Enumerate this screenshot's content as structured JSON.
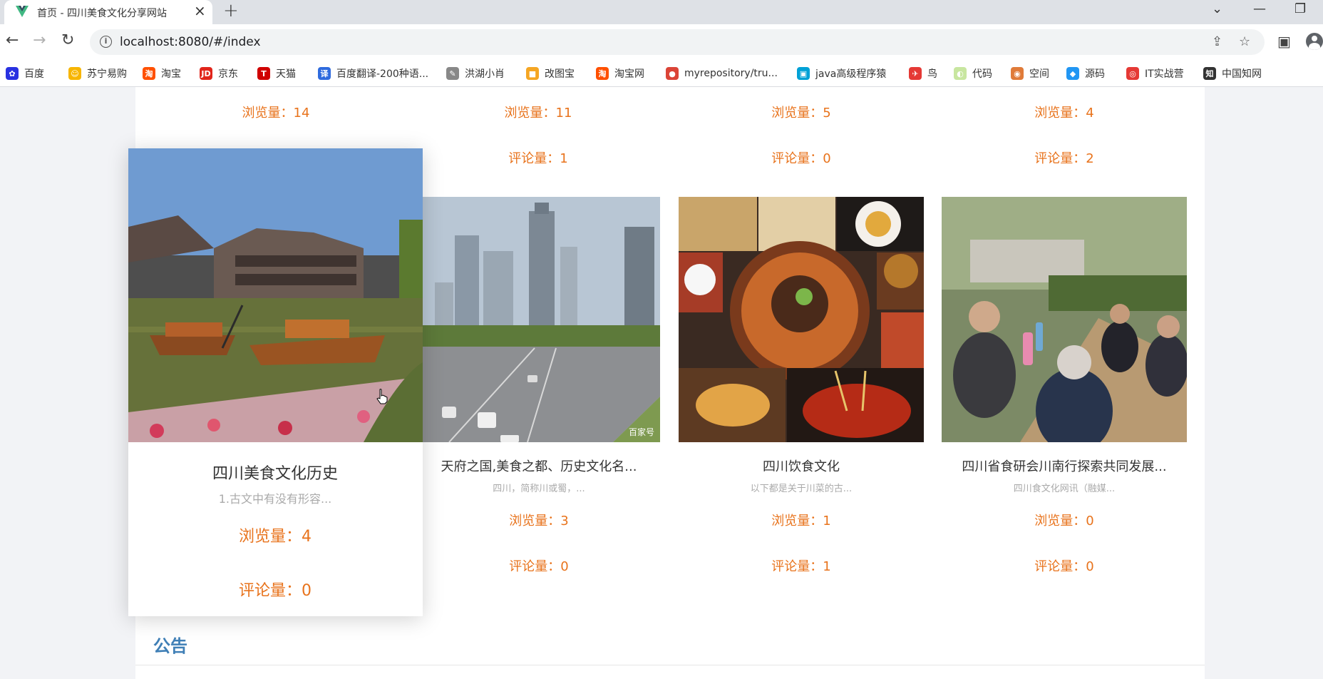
{
  "browser": {
    "tab_title": "首页 - 四川美食文化分享网站",
    "url": "localhost:8080/#/index",
    "bookmarks": [
      {
        "label": "百度",
        "icon": "baidu-icon",
        "color": "#2932e1",
        "glyph": "✿"
      },
      {
        "label": "苏宁易购",
        "icon": "suning-icon",
        "color": "#f7b500",
        "glyph": "☺"
      },
      {
        "label": "淘宝",
        "icon": "taobao-icon",
        "color": "#ff5000",
        "glyph": "淘"
      },
      {
        "label": "京东",
        "icon": "jd-icon",
        "color": "#e1251b",
        "glyph": "JD"
      },
      {
        "label": "天猫",
        "icon": "tmall-icon",
        "color": "#d00000",
        "glyph": "T"
      },
      {
        "label": "百度翻译-200种语...",
        "icon": "baidu-translate-icon",
        "color": "#2f6bde",
        "glyph": "译"
      },
      {
        "label": "洪湖小肖",
        "icon": "hongtu-icon",
        "color": "#888888",
        "glyph": "✎"
      },
      {
        "label": "改图宝",
        "icon": "gaitubao-icon",
        "color": "#f5a623",
        "glyph": "■"
      },
      {
        "label": "淘宝网",
        "icon": "taobao-net-icon",
        "color": "#ff5000",
        "glyph": "淘"
      },
      {
        "label": "myrepository/tru...",
        "icon": "chrome-icon",
        "color": "#db4437",
        "glyph": "●"
      },
      {
        "label": "java高级程序猿",
        "icon": "bilibili-icon",
        "color": "#00a1d6",
        "glyph": "▣"
      },
      {
        "label": "鸟",
        "icon": "bird-icon",
        "color": "#e53935",
        "glyph": "✈"
      },
      {
        "label": "代码",
        "icon": "code-icon",
        "color": "#c8e6a0",
        "glyph": "◐"
      },
      {
        "label": "空间",
        "icon": "space-icon",
        "color": "#e07b39",
        "glyph": "◉"
      },
      {
        "label": "源码",
        "icon": "source-icon",
        "color": "#2196f3",
        "glyph": "◆"
      },
      {
        "label": "IT实战营",
        "icon": "it-camp-icon",
        "color": "#e53935",
        "glyph": "◎"
      },
      {
        "label": "中国知网",
        "icon": "cnki-icon",
        "color": "#333333",
        "glyph": "知"
      }
    ]
  },
  "page": {
    "top_row_stats": [
      {
        "views": "浏览量：14",
        "comments": ""
      },
      {
        "views": "浏览量：11",
        "comments": "评论量：1"
      },
      {
        "views": "浏览量：5",
        "comments": "评论量：0"
      },
      {
        "views": "浏览量：4",
        "comments": "评论量：2"
      }
    ],
    "hover_card": {
      "title": "四川美食文化历史",
      "desc": "1.古文中有没有形容...",
      "views": "浏览量：4",
      "comments": "评论量：0"
    },
    "cards": [
      {
        "title": "天府之国,美食之都、历史文化名...",
        "desc": "四川，简称川或蜀，...",
        "views": "浏览量：3",
        "comments": "评论量：0",
        "image": "city-avenue-photo"
      },
      {
        "title": "四川饮食文化",
        "desc": "以下都是关于川菜的古...",
        "views": "浏览量：1",
        "comments": "评论量：1",
        "image": "sichuan-dishes-collage"
      },
      {
        "title": "四川省食研会川南行探索共同发展...",
        "desc": "四川食文化网讯（融媒...",
        "views": "浏览量：0",
        "comments": "评论量：0",
        "image": "meeting-photo"
      }
    ],
    "watermark": "百家号",
    "notice_title": "公告"
  }
}
